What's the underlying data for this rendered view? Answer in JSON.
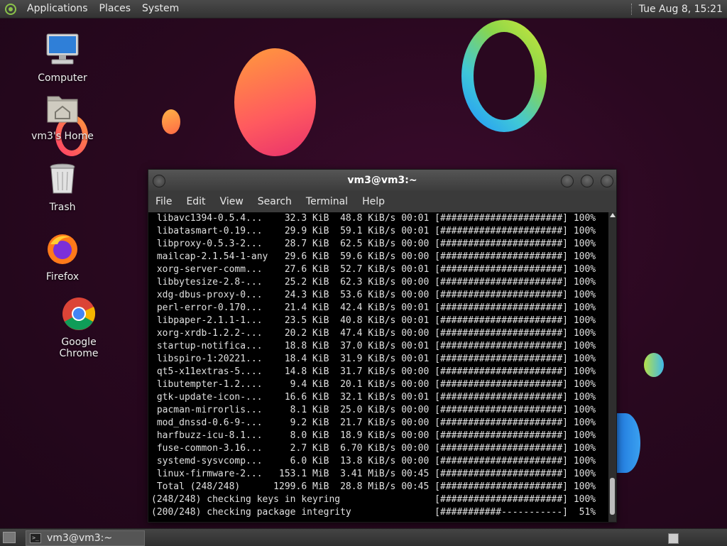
{
  "top_panel": {
    "menus": [
      "Applications",
      "Places",
      "System"
    ],
    "clock": "Tue Aug  8, 15:21"
  },
  "desktop_icons": [
    {
      "label": "Computer",
      "icon": "computer-icon"
    },
    {
      "label": "vm3's Home",
      "icon": "home-folder-icon"
    },
    {
      "label": "Trash",
      "icon": "trash-icon"
    },
    {
      "label": "Firefox",
      "icon": "firefox-icon"
    },
    {
      "label": "Google Chrome",
      "icon": "chrome-icon"
    }
  ],
  "terminal": {
    "title": "vm3@vm3:~",
    "menu": [
      "File",
      "Edit",
      "View",
      "Search",
      "Terminal",
      "Help"
    ],
    "lines": [
      " libavc1394-0.5.4...    32.3 KiB  48.8 KiB/s 00:01 [######################] 100%",
      " libatasmart-0.19...    29.9 KiB  59.1 KiB/s 00:01 [######################] 100%",
      " libproxy-0.5.3-2...    28.7 KiB  62.5 KiB/s 00:00 [######################] 100%",
      " mailcap-2.1.54-1-any   29.6 KiB  59.6 KiB/s 00:00 [######################] 100%",
      " xorg-server-comm...    27.6 KiB  52.7 KiB/s 00:01 [######################] 100%",
      " libbytesize-2.8-...    25.2 KiB  62.3 KiB/s 00:00 [######################] 100%",
      " xdg-dbus-proxy-0...    24.3 KiB  53.6 KiB/s 00:00 [######################] 100%",
      " perl-error-0.170...    21.4 KiB  42.4 KiB/s 00:01 [######################] 100%",
      " libpaper-2.1.1-1...    23.5 KiB  40.8 KiB/s 00:01 [######################] 100%",
      " xorg-xrdb-1.2.2-...    20.2 KiB  47.4 KiB/s 00:00 [######################] 100%",
      " startup-notifica...    18.8 KiB  37.0 KiB/s 00:01 [######################] 100%",
      " libspiro-1:20221...    18.4 KiB  31.9 KiB/s 00:01 [######################] 100%",
      " qt5-x11extras-5....    14.8 KiB  31.7 KiB/s 00:00 [######################] 100%",
      " libutempter-1.2....     9.4 KiB  20.1 KiB/s 00:00 [######################] 100%",
      " gtk-update-icon-...    16.6 KiB  32.1 KiB/s 00:01 [######################] 100%",
      " pacman-mirrorlis...     8.1 KiB  25.0 KiB/s 00:00 [######################] 100%",
      " mod_dnssd-0.6-9-...     9.2 KiB  21.7 KiB/s 00:00 [######################] 100%",
      " harfbuzz-icu-8.1...     8.0 KiB  18.9 KiB/s 00:00 [######################] 100%",
      " fuse-common-3.16...     2.7 KiB  6.70 KiB/s 00:00 [######################] 100%",
      " systemd-sysvcomp...     6.0 KiB  13.8 KiB/s 00:00 [######################] 100%",
      " linux-firmware-2...   153.1 MiB  3.41 MiB/s 00:45 [######################] 100%",
      " Total (248/248)      1299.6 MiB  28.8 MiB/s 00:45 [######################] 100%",
      "(248/248) checking keys in keyring                 [######################] 100%",
      "(200/248) checking package integrity               [###########-----------]  51%"
    ]
  },
  "bottom_panel": {
    "task_label": "vm3@vm3:~"
  },
  "colors": {
    "wallpaper": "#2a0820",
    "terminal_bg": "#000000",
    "terminal_fg": "#e0e0e0"
  }
}
